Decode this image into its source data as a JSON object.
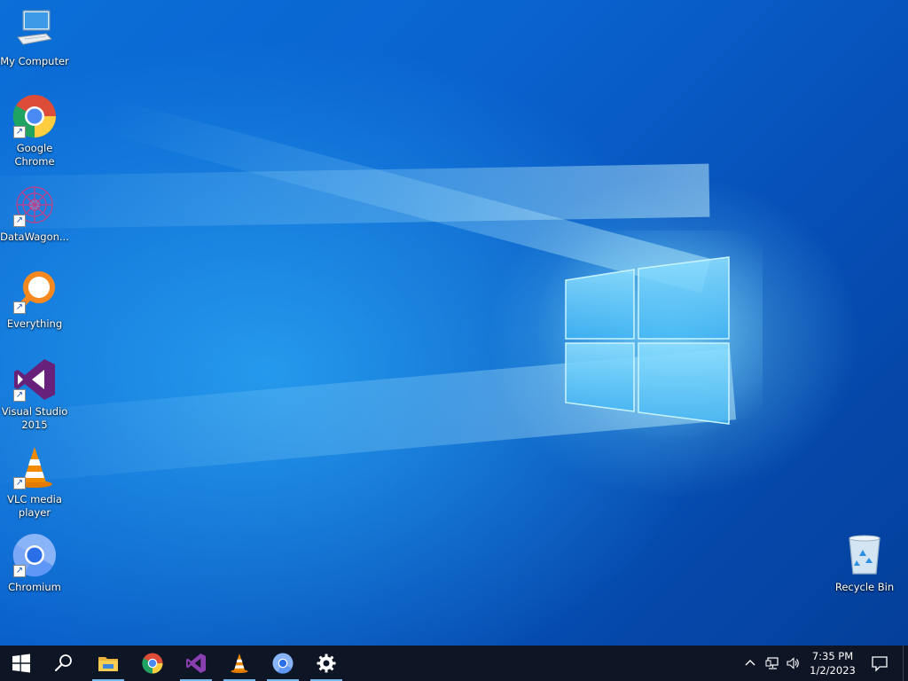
{
  "desktop": {
    "icons": [
      {
        "label": "My Computer",
        "icon": "computer-icon"
      },
      {
        "label": "Google\nChrome",
        "icon": "chrome-icon"
      },
      {
        "label": "DataWagon...",
        "icon": "datawagon-icon"
      },
      {
        "label": "Everything",
        "icon": "everything-search-icon"
      },
      {
        "label": "Visual Studio\n2015",
        "icon": "visual-studio-icon"
      },
      {
        "label": "VLC media\nplayer",
        "icon": "vlc-icon"
      },
      {
        "label": "Chromium",
        "icon": "chromium-icon"
      },
      {
        "label": "Recycle Bin",
        "icon": "recycle-bin-icon"
      }
    ],
    "shortcut_arrow": "↗"
  },
  "taskbar": {
    "buttons": [
      {
        "name": "start",
        "icon": "windows-start-icon"
      },
      {
        "name": "search",
        "icon": "search-icon"
      },
      {
        "name": "file-explorer",
        "icon": "folder-icon"
      },
      {
        "name": "chrome",
        "icon": "chrome-icon"
      },
      {
        "name": "visual-studio",
        "icon": "visual-studio-icon"
      },
      {
        "name": "vlc",
        "icon": "vlc-icon"
      },
      {
        "name": "chromium",
        "icon": "chromium-icon"
      },
      {
        "name": "settings",
        "icon": "gear-icon"
      }
    ],
    "tray": {
      "icons": [
        "chevron-up-icon",
        "network-icon",
        "volume-icon"
      ]
    },
    "clock": {
      "time": "7:35 PM",
      "date": "1/2/2023"
    }
  },
  "colors": {
    "taskbar": "#0e1626",
    "accent": "#76b9ed",
    "wallpaper_blue": "#0a63cf",
    "vs_purple": "#68217a",
    "vlc_orange": "#f08a00",
    "everything_orange": "#f5891f"
  }
}
